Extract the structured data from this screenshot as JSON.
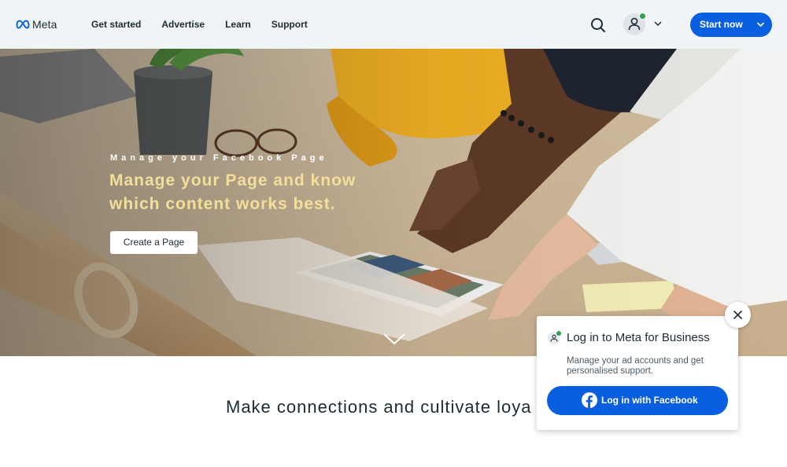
{
  "header": {
    "logo_text": "Meta",
    "nav": [
      {
        "label": "Get started"
      },
      {
        "label": "Advertise"
      },
      {
        "label": "Learn"
      },
      {
        "label": "Support"
      }
    ],
    "search_icon": "search-icon",
    "account_icon": "person-icon",
    "account_status": "online",
    "start_button": {
      "label": "Start now"
    }
  },
  "hero": {
    "eyebrow": "Manage your Facebook Page",
    "title": "Manage your Page and know which content works best.",
    "cta_label": "Create a Page",
    "scroll_icon": "chevron-down-icon"
  },
  "section": {
    "heading": "Make connections and cultivate loya"
  },
  "login_popup": {
    "title": "Log in to Meta for Business",
    "description": "Manage your ad accounts and get personalised support.",
    "button_label": "Log in with Facebook",
    "close_icon": "close-icon"
  },
  "colors": {
    "accent": "#0a5ee0",
    "header_bg": "#f1f4f7",
    "hero_title": "#f3df9c",
    "online_dot": "#31a24c"
  }
}
